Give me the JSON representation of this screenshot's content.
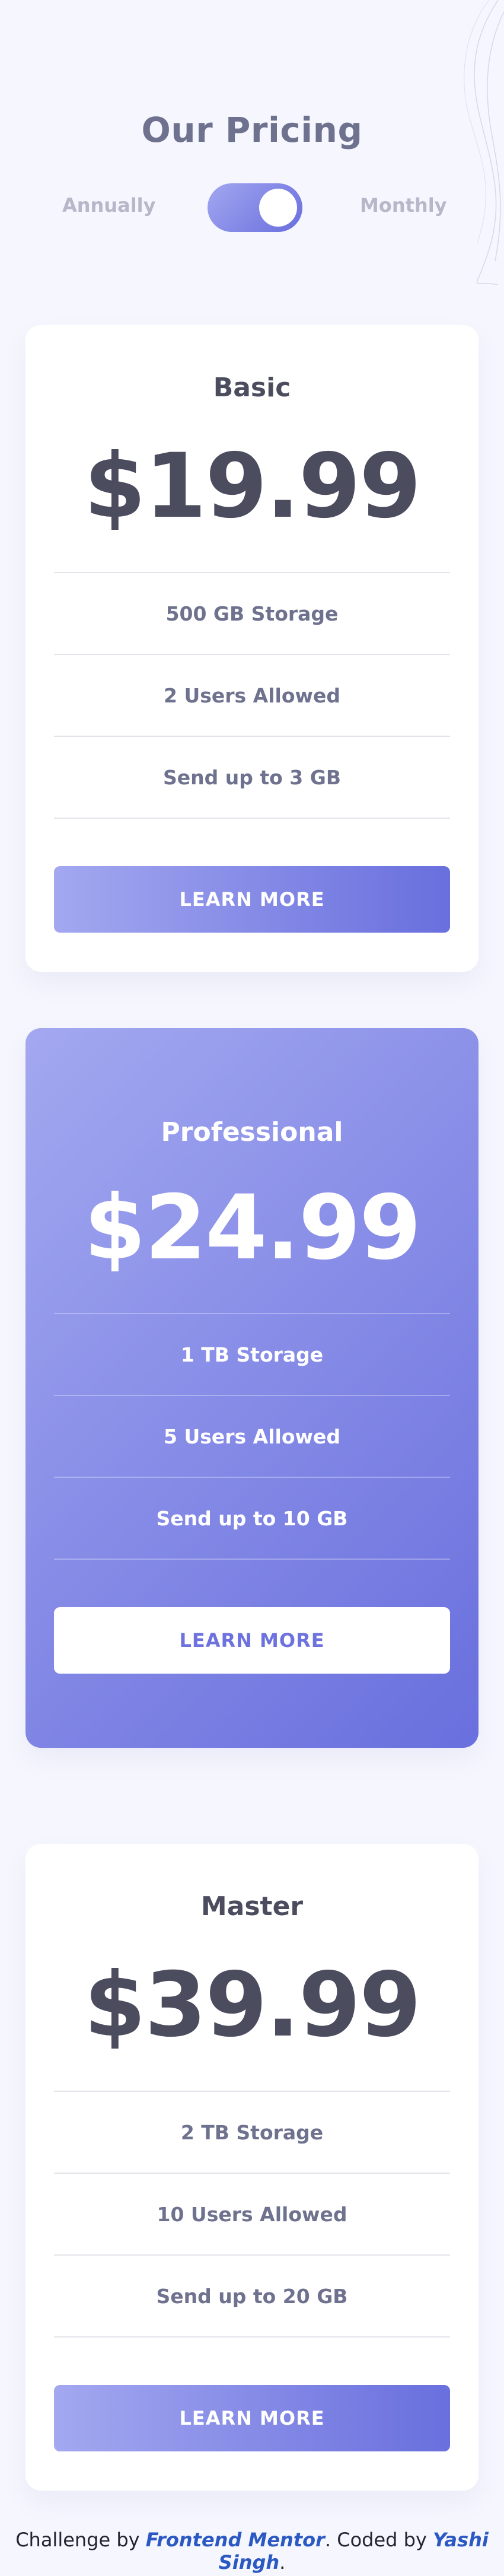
{
  "header": {
    "title": "Our Pricing"
  },
  "billing_toggle": {
    "left_label": "Annually",
    "right_label": "Monthly",
    "selected": "Monthly"
  },
  "plans": [
    {
      "name": "Basic",
      "price": "$19.99",
      "features": [
        "500 GB Storage",
        "2 Users Allowed",
        "Send up to 3 GB"
      ],
      "cta": "LEARN MORE"
    },
    {
      "name": "Professional",
      "price": "$24.99",
      "features": [
        "1 TB Storage",
        "5 Users Allowed",
        "Send up to 10 GB"
      ],
      "cta": "LEARN MORE"
    },
    {
      "name": "Master",
      "price": "$39.99",
      "features": [
        "2 TB Storage",
        "10 Users Allowed",
        "Send up to 20 GB"
      ],
      "cta": "LEARN MORE"
    }
  ],
  "footer": {
    "prefix": "Challenge by ",
    "challenge_link": "Frontend Mentor",
    "middle": ". Coded by ",
    "author_link": "Yashi Singh",
    "suffix": "."
  },
  "colors": {
    "background": "#f6f6fe",
    "gradient_start": "#a3a8f0",
    "gradient_end": "#696fdd",
    "heading": "#4b4d5f",
    "muted": "#6e728e"
  }
}
